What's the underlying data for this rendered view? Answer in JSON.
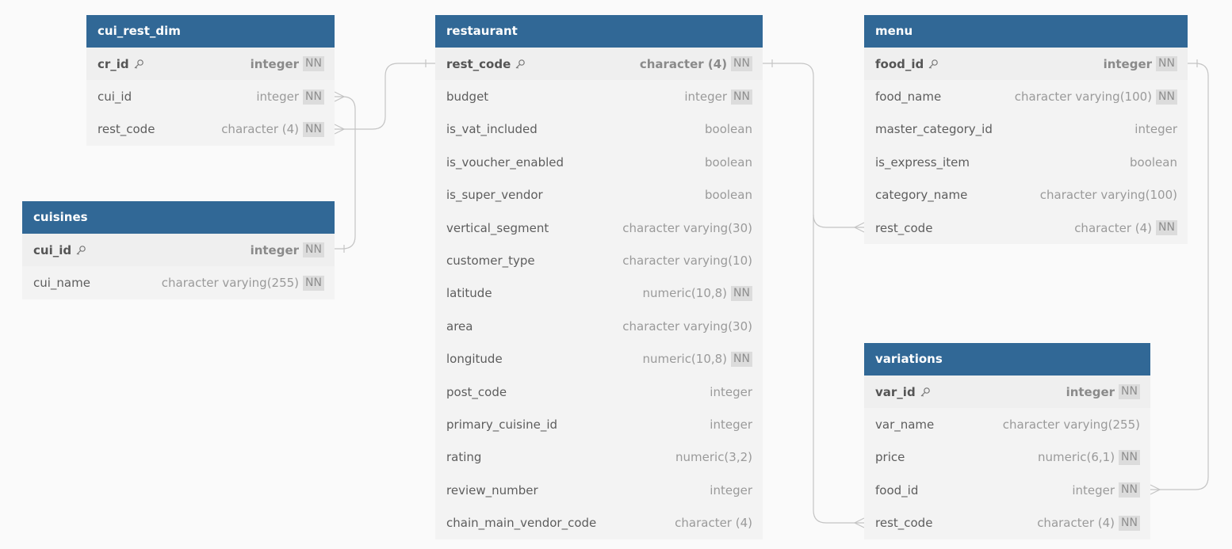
{
  "diagram": {
    "tables": [
      {
        "id": "cui_rest_dim",
        "name": "cui_rest_dim",
        "columns": [
          {
            "name": "cr_id",
            "type": "integer",
            "nn": "NN",
            "pk": true
          },
          {
            "name": "cui_id",
            "type": "integer",
            "nn": "NN",
            "pk": false
          },
          {
            "name": "rest_code",
            "type": "character (4)",
            "nn": "NN",
            "pk": false
          }
        ]
      },
      {
        "id": "cuisines",
        "name": "cuisines",
        "columns": [
          {
            "name": "cui_id",
            "type": "integer",
            "nn": "NN",
            "pk": true
          },
          {
            "name": "cui_name",
            "type": "character varying(255)",
            "nn": "NN",
            "pk": false
          }
        ]
      },
      {
        "id": "restaurant",
        "name": "restaurant",
        "columns": [
          {
            "name": "rest_code",
            "type": "character (4)",
            "nn": "NN",
            "pk": true
          },
          {
            "name": "budget",
            "type": "integer",
            "nn": "NN",
            "pk": false
          },
          {
            "name": "is_vat_included",
            "type": "boolean",
            "nn": "",
            "pk": false
          },
          {
            "name": "is_voucher_enabled",
            "type": "boolean",
            "nn": "",
            "pk": false
          },
          {
            "name": "is_super_vendor",
            "type": "boolean",
            "nn": "",
            "pk": false
          },
          {
            "name": "vertical_segment",
            "type": "character varying(30)",
            "nn": "",
            "pk": false
          },
          {
            "name": "customer_type",
            "type": "character varying(10)",
            "nn": "",
            "pk": false
          },
          {
            "name": "latitude",
            "type": "numeric(10,8)",
            "nn": "NN",
            "pk": false
          },
          {
            "name": "area",
            "type": "character varying(30)",
            "nn": "",
            "pk": false
          },
          {
            "name": "longitude",
            "type": "numeric(10,8)",
            "nn": "NN",
            "pk": false
          },
          {
            "name": "post_code",
            "type": "integer",
            "nn": "",
            "pk": false
          },
          {
            "name": "primary_cuisine_id",
            "type": "integer",
            "nn": "",
            "pk": false
          },
          {
            "name": "rating",
            "type": "numeric(3,2)",
            "nn": "",
            "pk": false
          },
          {
            "name": "review_number",
            "type": "integer",
            "nn": "",
            "pk": false
          },
          {
            "name": "chain_main_vendor_code",
            "type": "character (4)",
            "nn": "",
            "pk": false
          }
        ]
      },
      {
        "id": "menu",
        "name": "menu",
        "columns": [
          {
            "name": "food_id",
            "type": "integer",
            "nn": "NN",
            "pk": true
          },
          {
            "name": "food_name",
            "type": "character varying(100)",
            "nn": "NN",
            "pk": false
          },
          {
            "name": "master_category_id",
            "type": "integer",
            "nn": "",
            "pk": false
          },
          {
            "name": "is_express_item",
            "type": "boolean",
            "nn": "",
            "pk": false
          },
          {
            "name": "category_name",
            "type": "character varying(100)",
            "nn": "",
            "pk": false
          },
          {
            "name": "rest_code",
            "type": "character (4)",
            "nn": "NN",
            "pk": false
          }
        ]
      },
      {
        "id": "variations",
        "name": "variations",
        "columns": [
          {
            "name": "var_id",
            "type": "integer",
            "nn": "NN",
            "pk": true
          },
          {
            "name": "var_name",
            "type": "character varying(255)",
            "nn": "",
            "pk": false
          },
          {
            "name": "price",
            "type": "numeric(6,1)",
            "nn": "NN",
            "pk": false
          },
          {
            "name": "food_id",
            "type": "integer",
            "nn": "NN",
            "pk": false
          },
          {
            "name": "rest_code",
            "type": "character (4)",
            "nn": "NN",
            "pk": false
          }
        ]
      }
    ],
    "relationships": [
      {
        "from": "cui_rest_dim.cui_id",
        "to": "cuisines.cui_id",
        "type": "many-to-one"
      },
      {
        "from": "cui_rest_dim.rest_code",
        "to": "restaurant.rest_code",
        "type": "many-to-one"
      },
      {
        "from": "menu.rest_code",
        "to": "restaurant.rest_code",
        "type": "many-to-one"
      },
      {
        "from": "variations.rest_code",
        "to": "restaurant.rest_code",
        "type": "many-to-one"
      },
      {
        "from": "variations.food_id",
        "to": "menu.food_id",
        "type": "many-to-one"
      }
    ],
    "colors": {
      "header": "#316896",
      "table_body": "#f3f3f3",
      "connector": "#c4c4c4",
      "nn_badge": "#dcdcdc"
    }
  }
}
